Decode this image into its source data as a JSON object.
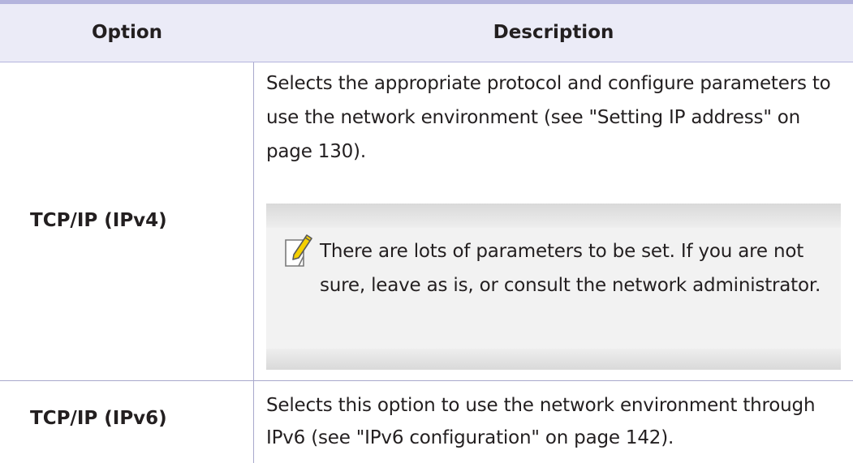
{
  "table": {
    "headers": {
      "option": "Option",
      "description": "Description"
    },
    "rows": [
      {
        "option": "TCP/IP (IPv4)",
        "description": "Selects the appropriate protocol and configure parameters to use the network environment (see \"Setting IP address\" on page 130).",
        "note": {
          "icon": "note-pencil-icon",
          "text": "There are lots of parameters to be set. If you are not sure, leave as is, or consult the network administrator."
        }
      },
      {
        "option": "TCP/IP (IPv6)",
        "description": "Selects this option to use the network environment through IPv6 (see \"IPv6 configuration\" on page 142)."
      }
    ]
  },
  "colors": {
    "header_background": "#ebebf7",
    "rule": "#b4b4dd",
    "note_background": "#f2f2f2",
    "note_icon_accent": "#f5d000"
  }
}
